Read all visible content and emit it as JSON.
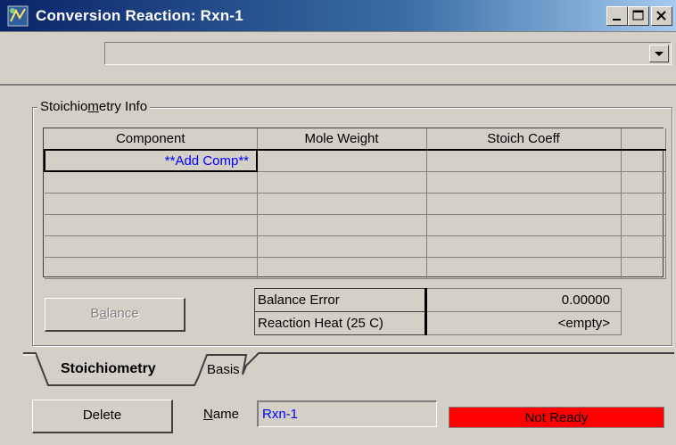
{
  "window": {
    "title": "Conversion Reaction: Rxn-1",
    "controls": {
      "minimize": "minimize",
      "maximize": "maximize",
      "close": "close"
    }
  },
  "top_dropdown": {
    "value": ""
  },
  "stoich_group": {
    "title_prefix": "Stoichio",
    "title_underlined": "m",
    "title_suffix": "etry Info",
    "columns": [
      "Component",
      "Mole Weight",
      "Stoich Coeff"
    ],
    "add_comp_label": "**Add Comp**",
    "empty_rows": 5
  },
  "balance_button": {
    "prefix": "B",
    "underlined": "a",
    "suffix": "lance"
  },
  "balance_info": {
    "error_label": "Balance Error",
    "error_value": "0.00000",
    "heat_label": "Reaction Heat (25 C)",
    "heat_value": "<empty>"
  },
  "tabs": {
    "active": "Stoichiometry",
    "basis": "Basis"
  },
  "bottom": {
    "delete_label": "Delete",
    "name_label_underlined": "N",
    "name_label_rest": "ame",
    "name_value": "Rxn-1",
    "status": "Not Ready"
  },
  "colors": {
    "status_bg": "#ff0000",
    "link_blue": "#0000ff",
    "face": "#d4d0c8"
  }
}
